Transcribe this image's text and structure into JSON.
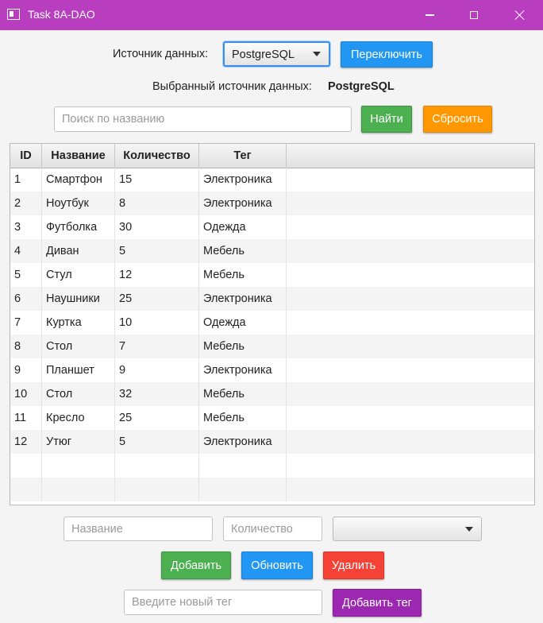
{
  "window": {
    "title": "Task 8A-DAO"
  },
  "source": {
    "label": "Источник данных:",
    "selected": "PostgreSQL",
    "switch_button": "Переключить",
    "current_label": "Выбранный источник данных:",
    "current_value": "PostgreSQL"
  },
  "search": {
    "placeholder": "Поиск по названию",
    "find_button": "Найти",
    "reset_button": "Сбросить"
  },
  "table": {
    "columns": [
      "ID",
      "Название",
      "Количество",
      "Тег"
    ],
    "rows": [
      [
        "1",
        "Смартфон",
        "15",
        "Электроника"
      ],
      [
        "2",
        "Ноутбук",
        "8",
        "Электроника"
      ],
      [
        "3",
        "Футболка",
        "30",
        "Одежда"
      ],
      [
        "4",
        "Диван",
        "5",
        "Мебель"
      ],
      [
        "5",
        "Стул",
        "12",
        "Мебель"
      ],
      [
        "6",
        "Наушники",
        "25",
        "Электроника"
      ],
      [
        "7",
        "Куртка",
        "10",
        "Одежда"
      ],
      [
        "8",
        "Стол",
        "7",
        "Мебель"
      ],
      [
        "9",
        "Планшет",
        "9",
        "Электроника"
      ],
      [
        "10",
        "Стол",
        "32",
        "Мебель"
      ],
      [
        "11",
        "Кресло",
        "25",
        "Мебель"
      ],
      [
        "12",
        "Утюг",
        "5",
        "Электроника"
      ]
    ]
  },
  "form": {
    "name_placeholder": "Название",
    "quantity_placeholder": "Количество",
    "tag_selected": "",
    "add_button": "Добавить",
    "update_button": "Обновить",
    "delete_button": "Удалить",
    "new_tag_placeholder": "Введите новый тег",
    "add_tag_button": "Добавить тег"
  },
  "colors": {
    "titlebar": "#b93dbf",
    "blue": "#2196f3",
    "green": "#4caf50",
    "orange": "#ff9800",
    "red": "#f44336",
    "purple": "#9c27b0"
  }
}
